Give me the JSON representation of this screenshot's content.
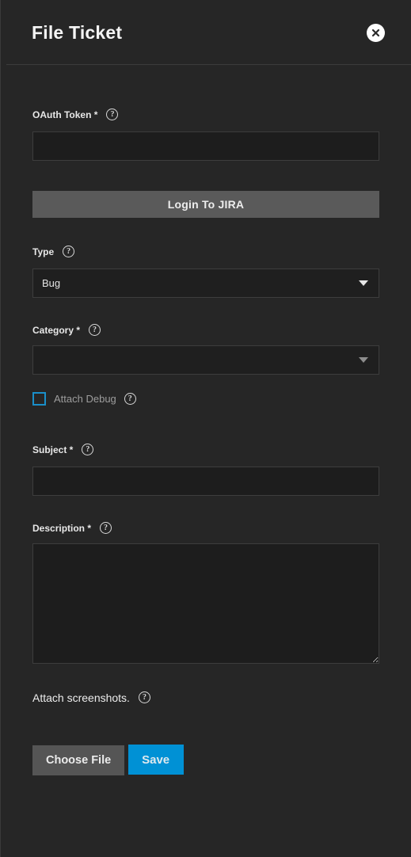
{
  "header": {
    "title": "File Ticket",
    "close_icon": "close-circle-icon"
  },
  "form": {
    "oauth": {
      "label": "OAuth Token",
      "required_marker": "*",
      "help_icon": "help-circle-icon",
      "value": "",
      "placeholder": ""
    },
    "login_button": {
      "label": "Login To JIRA"
    },
    "type": {
      "label": "Type",
      "help_icon": "help-circle-icon",
      "value": "Bug",
      "caret_icon": "chevron-down-icon"
    },
    "category": {
      "label": "Category",
      "required_marker": "*",
      "help_icon": "help-circle-icon",
      "value": "",
      "caret_icon": "chevron-down-icon"
    },
    "attach_debug": {
      "label": "Attach Debug",
      "checked": false,
      "help_icon": "help-circle-icon",
      "checkbox_color": "#1a8fc9"
    },
    "subject": {
      "label": "Subject",
      "required_marker": "*",
      "help_icon": "help-circle-icon",
      "value": "",
      "placeholder": ""
    },
    "description": {
      "label": "Description",
      "required_marker": "*",
      "help_icon": "help-circle-icon",
      "value": "",
      "placeholder": ""
    },
    "attach_screenshots": {
      "label": "Attach screenshots.",
      "help_icon": "help-circle-icon",
      "button_label": "Choose File"
    },
    "save_button": {
      "label": "Save",
      "color": "#0091d5"
    }
  },
  "theme": {
    "panel_background": "#262626",
    "input_background": "#1d1d1d",
    "accent": "#0091d5",
    "muted_text": "#9d9d9d"
  }
}
